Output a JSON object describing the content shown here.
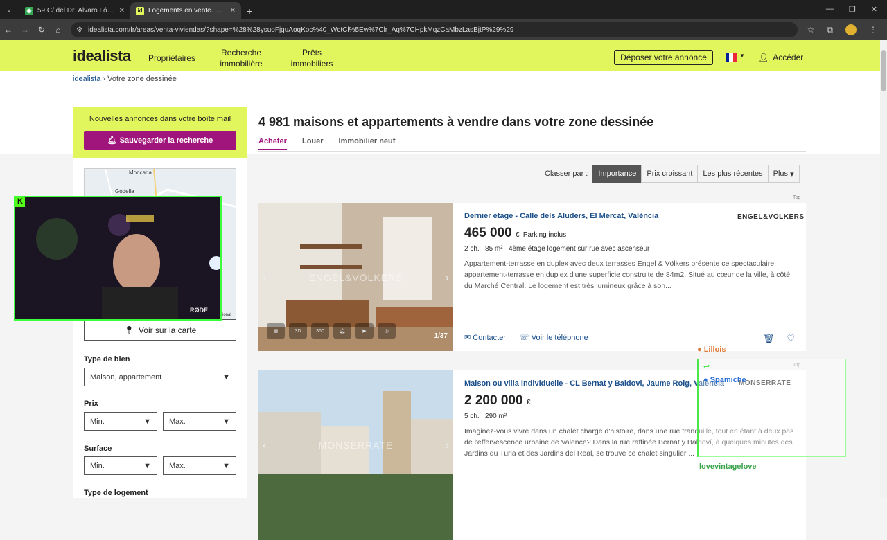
{
  "browser": {
    "tabs": [
      {
        "title": "59 C/ del Dr. Álvaro López - Go",
        "active": false
      },
      {
        "title": "Logements en vente. Logements",
        "active": true
      }
    ],
    "new_tab": "+",
    "url": "idealista.com/fr/areas/venta-viviendas/?shape=%28%28ysuoFjguAoqKoc%40_WctCl%5Ew%7Clr_Aq%7CHpkMqzCaMbzLasBjtP%29%29"
  },
  "header": {
    "logo": "idealista",
    "nav": [
      {
        "label": "Propriétaires"
      },
      {
        "label": "Recherche immobilière"
      },
      {
        "label": "Prêts immobiliers"
      }
    ],
    "post_ad": "Déposer votre annonce",
    "login": "Accéder"
  },
  "breadcrumb": {
    "home": "idealista",
    "separator": "›",
    "current": "Votre zone dessinée"
  },
  "sidebar": {
    "alert_text": "Nouvelles annonces dans votre boîte mail",
    "save_search": "Sauvegarder la recherche",
    "map_labels": {
      "moncada": "Moncada",
      "godella": "Godella",
      "attribution": "cional"
    },
    "see_map": "Voir sur la carte",
    "filters": {
      "type_label": "Type de bien",
      "type_value": "Maison, appartement",
      "price_label": "Prix",
      "price_min": "Min.",
      "price_max": "Max.",
      "surface_label": "Surface",
      "surface_min": "Min.",
      "surface_max": "Max.",
      "housing_type_label": "Type de logement"
    }
  },
  "main": {
    "title": "4 981 maisons et appartements à vendre dans votre zone dessinée",
    "operation_tabs": [
      "Acheter",
      "Louer",
      "Immobilier neuf"
    ],
    "sort": {
      "label": "Classer par :",
      "options": [
        "Importance",
        "Prix croissant",
        "Les plus récentes",
        "Plus"
      ],
      "selected": "Importance"
    }
  },
  "listings": [
    {
      "top_label": "Top",
      "title": "Dernier étage - Calle dels Aluders, El Mercat, València",
      "price": "465 000",
      "currency": "€",
      "extra": "Parking inclus",
      "details": [
        "2 ch.",
        "85 m²",
        "4ème étage logement sur rue avec ascenseur"
      ],
      "description": "Appartement-terrasse en duplex avec deux terrasses Engel & Völkers présente ce spectaculaire appartement-terrasse en duplex d'une superficie construite de 84m2. Situé au cœur de la ville, à côté du Marché Central. Le logement est très lumineux grâce à son...",
      "agency": "ENGEL&VÖLKERS",
      "watermark": "ENGEL&VÖLKERS",
      "photo_counter": "1/37",
      "photo_tags": [
        "3D",
        "360"
      ],
      "contact": "Contacter",
      "phone": "Voir le téléphone"
    },
    {
      "top_label": "Top",
      "title": "Maison ou villa individuelle - CL Bernat y Baldovi, Jaume Roig, València",
      "price": "2 200 000",
      "currency": "€",
      "details": [
        "5 ch.",
        "290 m²"
      ],
      "description": "Imaginez-vous vivre dans un chalet chargé d'histoire, dans une rue tranquille, tout en étant à deux pas de l'effervescence urbaine de Valence? Dans la rue raffinée Bernat y Baldoví, à quelques minutes des Jardins du Turia et des Jardins del Real, se trouve ce chalet singulier ...",
      "agency": "MONSERRATE",
      "watermark": "MONSERRATE"
    }
  ],
  "overlay": {
    "webcam_badge": "K",
    "mic_brand": "RØDE",
    "chat": [
      {
        "user": "Lillois",
        "text": ""
      },
      {
        "user": "Spamiche",
        "text": ""
      },
      {
        "user": "lovevintagelove",
        "text": ""
      }
    ]
  },
  "colors": {
    "brand_yellow": "#e1f55d",
    "brand_magenta": "#a0157c",
    "link_blue": "#1a4f8b"
  }
}
